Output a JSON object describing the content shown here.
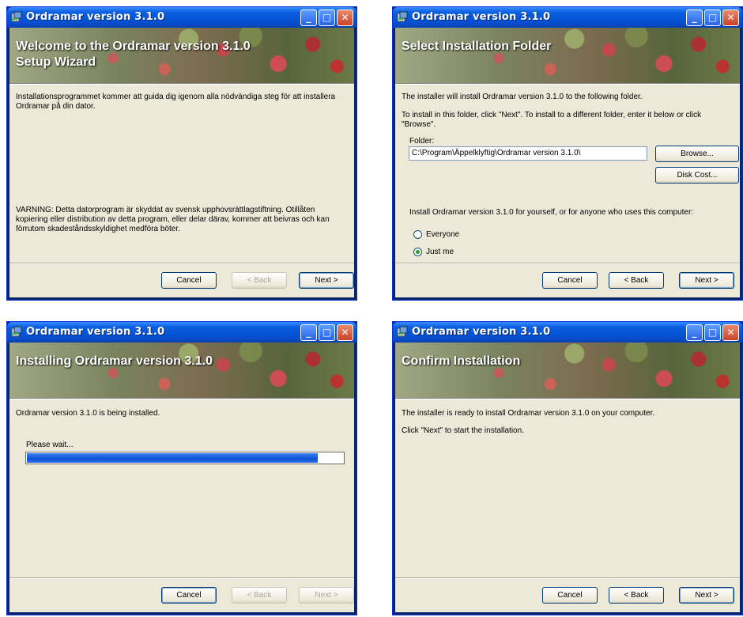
{
  "colors": {
    "titlebar": "#0454d6",
    "face": "#ece9d8",
    "progress": "#0b4fd6"
  },
  "app_title": "Ordramar version 3.1.0",
  "titlebar_icons": [
    "installer-icon",
    "minimize-icon",
    "maximize-icon",
    "close-icon"
  ],
  "buttons": {
    "cancel": "Cancel",
    "back": "< Back",
    "back_key": "B",
    "next": "Next >",
    "next_key": "N",
    "browse": "Browse...",
    "disk_cost": "Disk Cost..."
  },
  "welcome": {
    "heading": "Welcome to the Ordramar version 3.1.0 Setup Wizard",
    "intro": "Installationsprogrammet kommer att guida dig igenom alla nödvändiga steg för att installera Ordramar på din dator.",
    "warning": "VARNING: Detta datorprogram är skyddat av svensk upphovsrättlagstiftning. Otillåten kopiering eller distribution av detta program, eller delar därav, kommer att beivras och kan förrutom skadeståndsskyldighet medföra böter."
  },
  "folder": {
    "heading": "Select Installation Folder",
    "line1": "The installer will install Ordramar version 3.1.0 to the following folder.",
    "line2": "To install in this folder, click \"Next\". To install to a different folder, enter it below or click \"Browse\".",
    "folder_label": "Folder:",
    "folder_value": "C:\\Program\\Äppelklyftig\\Ordramar version 3.1.0\\",
    "scope_text": "Install Ordramar version 3.1.0 for yourself, or for anyone who uses this computer:",
    "options": [
      {
        "label": "Everyone",
        "selected": false
      },
      {
        "label": "Just me",
        "selected": true
      }
    ]
  },
  "installing": {
    "heading": "Installing Ordramar version 3.1.0",
    "status": "Ordramar version 3.1.0 is being installed.",
    "wait": "Please wait...",
    "progress_percent": 92
  },
  "confirm": {
    "heading": "Confirm Installation",
    "line1": "The installer is ready to install Ordramar version 3.1.0 on your computer.",
    "line2": "Click \"Next\" to start the installation."
  }
}
